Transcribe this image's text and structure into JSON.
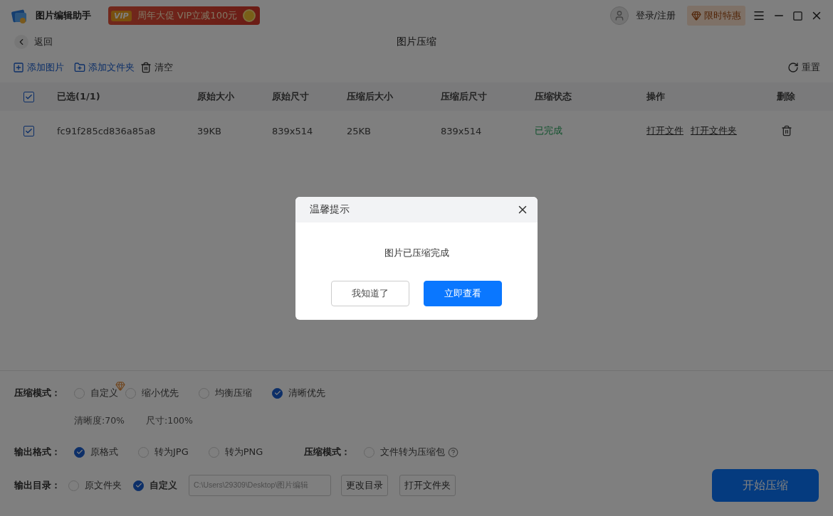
{
  "titlebar": {
    "app_name": "图片编辑助手",
    "promo": {
      "badge": "VIP",
      "text": "周年大促 VIP立减100元"
    },
    "login": "登录/注册",
    "offer": "限时特惠"
  },
  "nav": {
    "back": "返回",
    "title": "图片压缩"
  },
  "toolbar": {
    "add_image": "添加图片",
    "add_folder": "添加文件夹",
    "clear": "清空",
    "reset": "重置"
  },
  "table": {
    "all_checked": true,
    "columns": [
      "已选(1/1)",
      "原始大小",
      "原始尺寸",
      "压缩后大小",
      "压缩后尺寸",
      "压缩状态",
      "操作",
      "删除"
    ],
    "rows": [
      {
        "checked": true,
        "name": "fc91f285cd836a85a8",
        "original_size": "39KB",
        "original_dimensions": "839x514",
        "compressed_size": "25KB",
        "compressed_dimensions": "839x514",
        "status": "已完成",
        "actions": [
          "打开文件",
          "打开文件夹"
        ]
      }
    ]
  },
  "settings": {
    "compression_mode": {
      "label": "压缩模式：",
      "options": [
        {
          "label": "自定义",
          "selected": false,
          "vip": true
        },
        {
          "label": "缩小优先",
          "selected": false,
          "vip": false
        },
        {
          "label": "均衡压缩",
          "selected": false,
          "vip": false
        },
        {
          "label": "清晰优先",
          "selected": true,
          "vip": false
        }
      ],
      "details": [
        "清晰度:70%",
        "尺寸:100%"
      ]
    },
    "output_format": {
      "label": "输出格式：",
      "options": [
        {
          "label": "原格式",
          "selected": true
        },
        {
          "label": "转为JPG",
          "selected": false
        },
        {
          "label": "转为PNG",
          "selected": false
        }
      ]
    },
    "archive_mode": {
      "label": "压缩模式：",
      "option": {
        "label": "文件转为压缩包",
        "selected": false
      }
    },
    "output_dir": {
      "label": "输出目录：",
      "options": [
        {
          "label": "原文件夹",
          "selected": false
        },
        {
          "label": "自定义",
          "selected": true
        }
      ],
      "path": "C:\\Users\\29309\\Desktop\\图片编辑",
      "buttons": [
        "更改目录",
        "打开文件夹"
      ]
    },
    "start_button": "开始压缩"
  },
  "dialog": {
    "title": "温馨提示",
    "message": "图片已压缩完成",
    "buttons": [
      {
        "label": "我知道了",
        "kind": "secondary"
      },
      {
        "label": "立即查看",
        "kind": "primary"
      }
    ]
  }
}
